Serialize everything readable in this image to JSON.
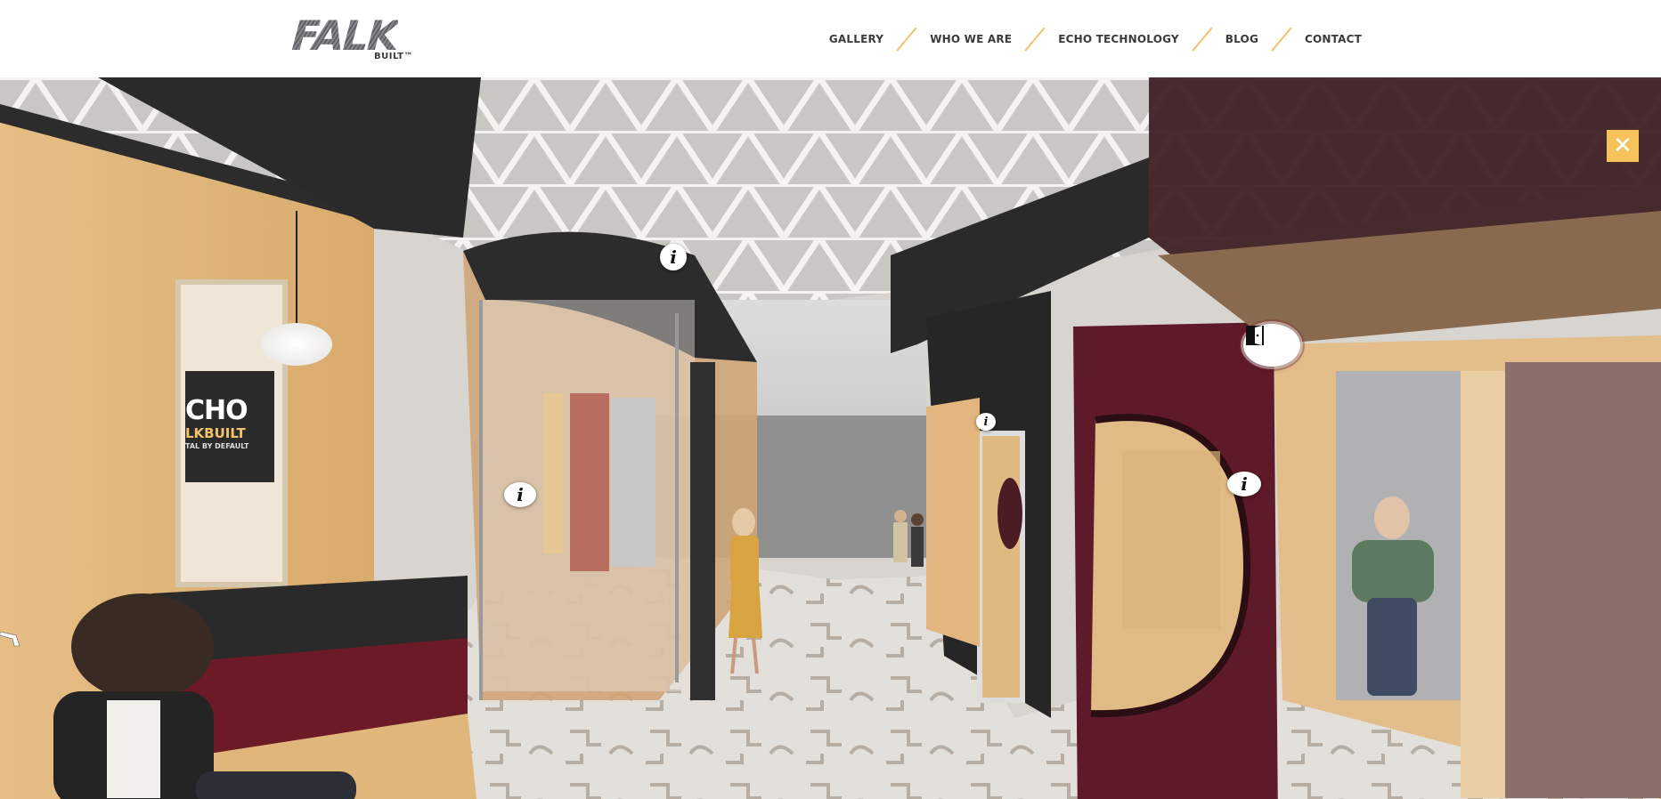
{
  "logo": {
    "main": "FALK",
    "sub": "BUILT™"
  },
  "nav": {
    "items": [
      {
        "label": "GALLERY"
      },
      {
        "label": "WHO WE ARE"
      },
      {
        "label": "ECHO TECHNOLOGY"
      },
      {
        "label": "BLOG"
      },
      {
        "label": "CONTACT"
      }
    ]
  },
  "tour": {
    "close_label": "✕",
    "hotspot_info_glyph": "i",
    "wall_sign": {
      "line1": "CHO",
      "line2": "LKBUILT",
      "line3": "TAL BY DEFAULT"
    }
  },
  "colors": {
    "accent": "#f6c25a",
    "nav_separator": "#f2c36b",
    "burgundy": "#5e1a28",
    "wood": "#e1b77d",
    "charcoal": "#2b2b2b"
  }
}
